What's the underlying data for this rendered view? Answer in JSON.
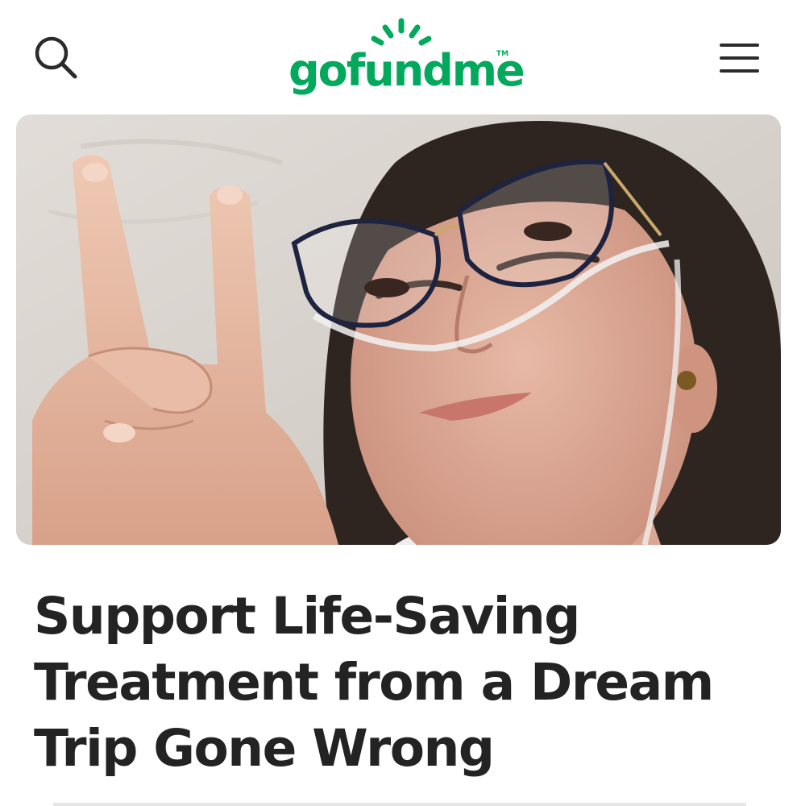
{
  "header": {
    "logo_text": "gofundme",
    "logo_tm": "TM",
    "search_icon": "search-icon",
    "menu_icon": "hamburger-menu-icon"
  },
  "hero": {
    "image_alt": "Fundraiser photo"
  },
  "campaign": {
    "title": "Support Life-Saving Treatment from a Dream Trip Gone Wrong"
  },
  "colors": {
    "brand_green": "#02a95c",
    "title_text": "#232323",
    "icon_dark": "#2b2b2b"
  }
}
